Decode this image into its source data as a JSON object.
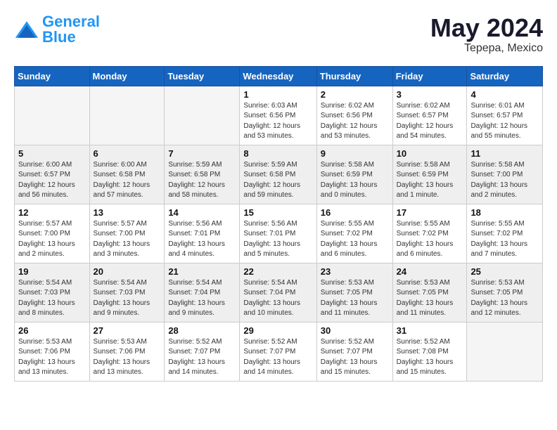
{
  "logo": {
    "general": "General",
    "blue": "Blue"
  },
  "header": {
    "title": "May 2024",
    "subtitle": "Tepepa, Mexico"
  },
  "weekdays": [
    "Sunday",
    "Monday",
    "Tuesday",
    "Wednesday",
    "Thursday",
    "Friday",
    "Saturday"
  ],
  "weeks": [
    [
      {
        "day": "",
        "info": ""
      },
      {
        "day": "",
        "info": ""
      },
      {
        "day": "",
        "info": ""
      },
      {
        "day": "1",
        "info": "Sunrise: 6:03 AM\nSunset: 6:56 PM\nDaylight: 12 hours\nand 53 minutes."
      },
      {
        "day": "2",
        "info": "Sunrise: 6:02 AM\nSunset: 6:56 PM\nDaylight: 12 hours\nand 53 minutes."
      },
      {
        "day": "3",
        "info": "Sunrise: 6:02 AM\nSunset: 6:57 PM\nDaylight: 12 hours\nand 54 minutes."
      },
      {
        "day": "4",
        "info": "Sunrise: 6:01 AM\nSunset: 6:57 PM\nDaylight: 12 hours\nand 55 minutes."
      }
    ],
    [
      {
        "day": "5",
        "info": "Sunrise: 6:00 AM\nSunset: 6:57 PM\nDaylight: 12 hours\nand 56 minutes."
      },
      {
        "day": "6",
        "info": "Sunrise: 6:00 AM\nSunset: 6:58 PM\nDaylight: 12 hours\nand 57 minutes."
      },
      {
        "day": "7",
        "info": "Sunrise: 5:59 AM\nSunset: 6:58 PM\nDaylight: 12 hours\nand 58 minutes."
      },
      {
        "day": "8",
        "info": "Sunrise: 5:59 AM\nSunset: 6:58 PM\nDaylight: 12 hours\nand 59 minutes."
      },
      {
        "day": "9",
        "info": "Sunrise: 5:58 AM\nSunset: 6:59 PM\nDaylight: 13 hours\nand 0 minutes."
      },
      {
        "day": "10",
        "info": "Sunrise: 5:58 AM\nSunset: 6:59 PM\nDaylight: 13 hours\nand 1 minute."
      },
      {
        "day": "11",
        "info": "Sunrise: 5:58 AM\nSunset: 7:00 PM\nDaylight: 13 hours\nand 2 minutes."
      }
    ],
    [
      {
        "day": "12",
        "info": "Sunrise: 5:57 AM\nSunset: 7:00 PM\nDaylight: 13 hours\nand 2 minutes."
      },
      {
        "day": "13",
        "info": "Sunrise: 5:57 AM\nSunset: 7:00 PM\nDaylight: 13 hours\nand 3 minutes."
      },
      {
        "day": "14",
        "info": "Sunrise: 5:56 AM\nSunset: 7:01 PM\nDaylight: 13 hours\nand 4 minutes."
      },
      {
        "day": "15",
        "info": "Sunrise: 5:56 AM\nSunset: 7:01 PM\nDaylight: 13 hours\nand 5 minutes."
      },
      {
        "day": "16",
        "info": "Sunrise: 5:55 AM\nSunset: 7:02 PM\nDaylight: 13 hours\nand 6 minutes."
      },
      {
        "day": "17",
        "info": "Sunrise: 5:55 AM\nSunset: 7:02 PM\nDaylight: 13 hours\nand 6 minutes."
      },
      {
        "day": "18",
        "info": "Sunrise: 5:55 AM\nSunset: 7:02 PM\nDaylight: 13 hours\nand 7 minutes."
      }
    ],
    [
      {
        "day": "19",
        "info": "Sunrise: 5:54 AM\nSunset: 7:03 PM\nDaylight: 13 hours\nand 8 minutes."
      },
      {
        "day": "20",
        "info": "Sunrise: 5:54 AM\nSunset: 7:03 PM\nDaylight: 13 hours\nand 9 minutes."
      },
      {
        "day": "21",
        "info": "Sunrise: 5:54 AM\nSunset: 7:04 PM\nDaylight: 13 hours\nand 9 minutes."
      },
      {
        "day": "22",
        "info": "Sunrise: 5:54 AM\nSunset: 7:04 PM\nDaylight: 13 hours\nand 10 minutes."
      },
      {
        "day": "23",
        "info": "Sunrise: 5:53 AM\nSunset: 7:05 PM\nDaylight: 13 hours\nand 11 minutes."
      },
      {
        "day": "24",
        "info": "Sunrise: 5:53 AM\nSunset: 7:05 PM\nDaylight: 13 hours\nand 11 minutes."
      },
      {
        "day": "25",
        "info": "Sunrise: 5:53 AM\nSunset: 7:05 PM\nDaylight: 13 hours\nand 12 minutes."
      }
    ],
    [
      {
        "day": "26",
        "info": "Sunrise: 5:53 AM\nSunset: 7:06 PM\nDaylight: 13 hours\nand 13 minutes."
      },
      {
        "day": "27",
        "info": "Sunrise: 5:53 AM\nSunset: 7:06 PM\nDaylight: 13 hours\nand 13 minutes."
      },
      {
        "day": "28",
        "info": "Sunrise: 5:52 AM\nSunset: 7:07 PM\nDaylight: 13 hours\nand 14 minutes."
      },
      {
        "day": "29",
        "info": "Sunrise: 5:52 AM\nSunset: 7:07 PM\nDaylight: 13 hours\nand 14 minutes."
      },
      {
        "day": "30",
        "info": "Sunrise: 5:52 AM\nSunset: 7:07 PM\nDaylight: 13 hours\nand 15 minutes."
      },
      {
        "day": "31",
        "info": "Sunrise: 5:52 AM\nSunset: 7:08 PM\nDaylight: 13 hours\nand 15 minutes."
      },
      {
        "day": "",
        "info": ""
      }
    ]
  ]
}
